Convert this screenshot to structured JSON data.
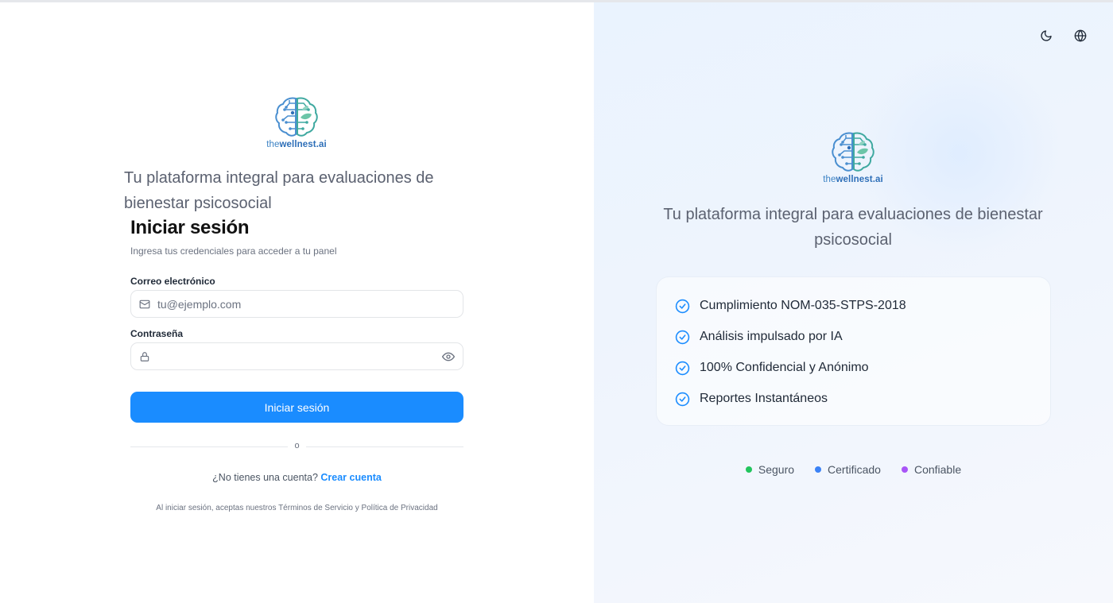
{
  "brand": {
    "prefix": "the",
    "name": "wellnest.ai",
    "accent_color": "#3b82c4"
  },
  "left": {
    "tagline": "Tu plataforma integral para evaluaciones de bienestar psicosocial",
    "login": {
      "title": "Iniciar sesión",
      "subtitle": "Ingresa tus credenciales para acceder a tu panel",
      "email_label": "Correo electrónico",
      "email_placeholder": "tu@ejemplo.com",
      "email_value": "",
      "password_label": "Contraseña",
      "password_value": "",
      "submit_label": "Iniciar sesión",
      "divider_text": "o",
      "signup_prompt": "¿No tienes una cuenta?",
      "signup_link": "Crear cuenta",
      "terms": "Al iniciar sesión, aceptas nuestros Términos de Servicio y Política de Privacidad",
      "primary_color": "#1a8cff"
    }
  },
  "right": {
    "icons": [
      "moon-icon",
      "globe-icon"
    ],
    "tagline": "Tu plataforma integral para evaluaciones de bienestar psicosocial",
    "features": [
      "Cumplimiento NOM-035-STPS-2018",
      "Análisis impulsado por IA",
      "100% Confidencial y Anónimo",
      "Reportes Instantáneos"
    ],
    "badges": [
      {
        "label": "Seguro",
        "color": "#22c55e"
      },
      {
        "label": "Certificado",
        "color": "#3b82f6"
      },
      {
        "label": "Confiable",
        "color": "#a855f7"
      }
    ]
  }
}
